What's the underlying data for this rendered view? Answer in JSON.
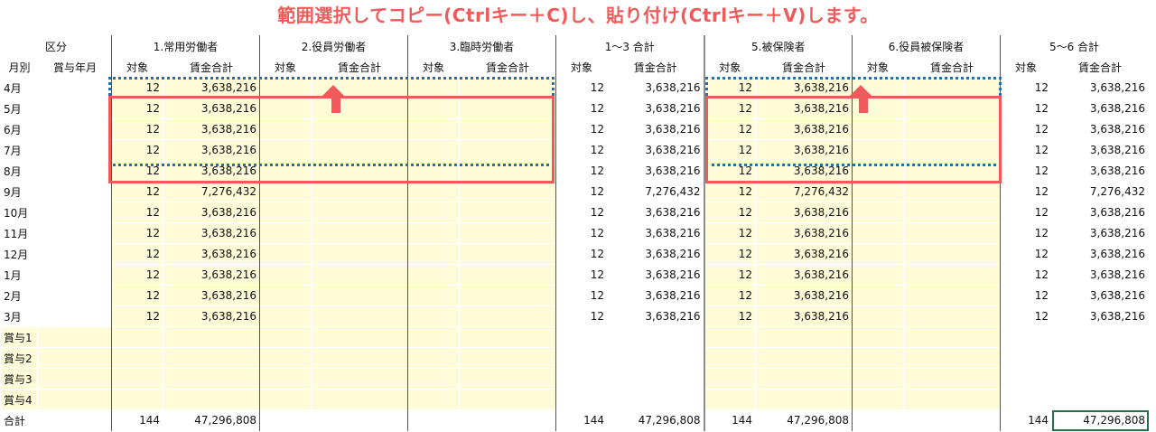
{
  "title": "範囲選択してコピー(Ctrlキー＋C)し、貼り付け(Ctrlキー＋V)します。",
  "groups": {
    "kubun": "区分",
    "g1": "1.常用労働者",
    "g2": "2.役員労働者",
    "g3": "3.臨時労働者",
    "g13": "1〜3 合計",
    "g5": "5.被保険者",
    "g6": "6.役員被保険者",
    "g56": "5〜6 合計"
  },
  "sub": {
    "month": "月別",
    "bonusmonth": "賞与年月",
    "count": "対象",
    "wage": "賃金合計"
  },
  "rows": [
    {
      "label": "4月",
      "c1": "12",
      "w1": "3,638,216",
      "c13": "12",
      "w13": "3,638,216",
      "c5": "12",
      "w5": "3,638,216",
      "c56": "12",
      "w56": "3,638,216"
    },
    {
      "label": "5月",
      "c1": "12",
      "w1": "3,638,216",
      "c13": "12",
      "w13": "3,638,216",
      "c5": "12",
      "w5": "3,638,216",
      "c56": "12",
      "w56": "3,638,216"
    },
    {
      "label": "6月",
      "c1": "12",
      "w1": "3,638,216",
      "c13": "12",
      "w13": "3,638,216",
      "c5": "12",
      "w5": "3,638,216",
      "c56": "12",
      "w56": "3,638,216"
    },
    {
      "label": "7月",
      "c1": "12",
      "w1": "3,638,216",
      "c13": "12",
      "w13": "3,638,216",
      "c5": "12",
      "w5": "3,638,216",
      "c56": "12",
      "w56": "3,638,216"
    },
    {
      "label": "8月",
      "c1": "12",
      "w1": "3,638,216",
      "c13": "12",
      "w13": "3,638,216",
      "c5": "12",
      "w5": "3,638,216",
      "c56": "12",
      "w56": "3,638,216"
    },
    {
      "label": "9月",
      "c1": "12",
      "w1": "7,276,432",
      "c13": "12",
      "w13": "7,276,432",
      "c5": "12",
      "w5": "7,276,432",
      "c56": "12",
      "w56": "7,276,432"
    },
    {
      "label": "10月",
      "c1": "12",
      "w1": "3,638,216",
      "c13": "12",
      "w13": "3,638,216",
      "c5": "12",
      "w5": "3,638,216",
      "c56": "12",
      "w56": "3,638,216"
    },
    {
      "label": "11月",
      "c1": "12",
      "w1": "3,638,216",
      "c13": "12",
      "w13": "3,638,216",
      "c5": "12",
      "w5": "3,638,216",
      "c56": "12",
      "w56": "3,638,216"
    },
    {
      "label": "12月",
      "c1": "12",
      "w1": "3,638,216",
      "c13": "12",
      "w13": "3,638,216",
      "c5": "12",
      "w5": "3,638,216",
      "c56": "12",
      "w56": "3,638,216"
    },
    {
      "label": "1月",
      "c1": "12",
      "w1": "3,638,216",
      "c13": "12",
      "w13": "3,638,216",
      "c5": "12",
      "w5": "3,638,216",
      "c56": "12",
      "w56": "3,638,216"
    },
    {
      "label": "2月",
      "c1": "12",
      "w1": "3,638,216",
      "c13": "12",
      "w13": "3,638,216",
      "c5": "12",
      "w5": "3,638,216",
      "c56": "12",
      "w56": "3,638,216"
    },
    {
      "label": "3月",
      "c1": "12",
      "w1": "3,638,216",
      "c13": "12",
      "w13": "3,638,216",
      "c5": "12",
      "w5": "3,638,216",
      "c56": "12",
      "w56": "3,638,216"
    }
  ],
  "bonus_rows": [
    "賞与1",
    "賞与2",
    "賞与3",
    "賞与4"
  ],
  "total": {
    "label": "合計",
    "c1": "144",
    "w1": "47,296,808",
    "c13": "144",
    "w13": "47,296,808",
    "c5": "144",
    "w5": "47,296,808",
    "c56": "144",
    "w56": "47,296,808"
  },
  "colors": {
    "title": "#f05a5a",
    "highlight": "#fdfbd8",
    "red_box": "#f05a5a",
    "blue_box": "#1f6fbf",
    "selection": "#217346"
  },
  "icons": [
    "up-arrow-icon"
  ]
}
